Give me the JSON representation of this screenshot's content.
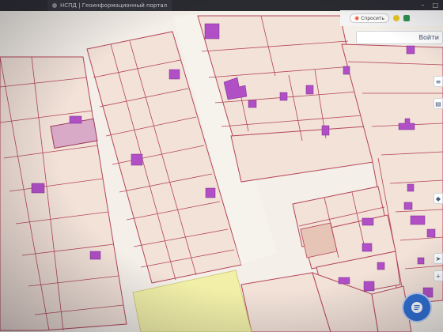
{
  "browser": {
    "tab_title": "НСПД | Геоинформационный портал",
    "ask_label": "Спросить"
  },
  "portal": {
    "login_label": "Войти"
  },
  "colors": {
    "parcel_fill": "#f2e1d6",
    "parcel_border": "#b5455a",
    "building_fill": "#b04fc6",
    "road_fill": "#f4efe7",
    "green_zone": "#f2f0a8",
    "accent": "#2f6fd4"
  },
  "icons": [
    "ask-icon",
    "chat-icon",
    "layers-icon",
    "compass-icon",
    "location-icon",
    "list-icon"
  ]
}
